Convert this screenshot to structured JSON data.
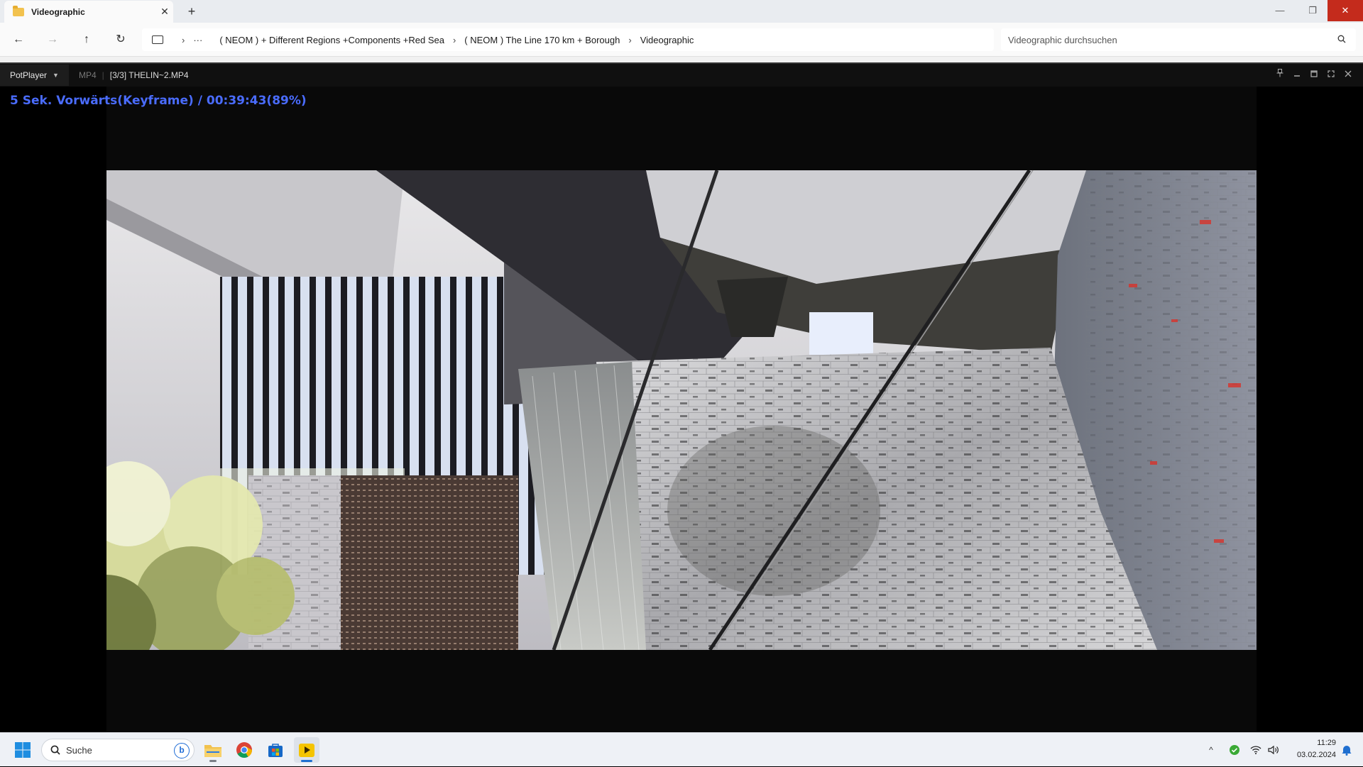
{
  "explorer": {
    "tab_title": "Videographic",
    "tab_close": "✕",
    "new_tab": "+",
    "window_controls": {
      "minimize": "—",
      "restore": "❐",
      "close": "✕"
    },
    "nav": {
      "back": "←",
      "forward": "→",
      "up": "↑",
      "refresh": "↻"
    },
    "breadcrumb_more": "···",
    "breadcrumb_sep": "›",
    "breadcrumbs": [
      "( NEOM ) + Different Regions +Components +Red Sea",
      "( NEOM ) The Line 170 km + Borough",
      "Videographic"
    ],
    "search_placeholder": "Videographic durchsuchen"
  },
  "potplayer": {
    "brand": "PotPlayer",
    "format": "MP4",
    "separator": "|",
    "file": "[3/3] THELIN~2.MP4",
    "osd": "5  Sek. Vorwärts(Keyframe) / 00:39:43(89%)",
    "controls": [
      "pin-icon",
      "minimize-icon",
      "maximize-icon",
      "fullscreen-icon",
      "close-icon"
    ]
  },
  "taskbar": {
    "search_placeholder": "Suche",
    "bing": "b",
    "apps": [
      "file-explorer",
      "chrome",
      "store",
      "potplayer"
    ],
    "tray_chevron": "^",
    "time": "11:29",
    "date": "03.02.2024"
  },
  "colors": {
    "osd_text": "#4a6cff",
    "close_red": "#c42b1c",
    "folder_yellow": "#f2c24e"
  }
}
